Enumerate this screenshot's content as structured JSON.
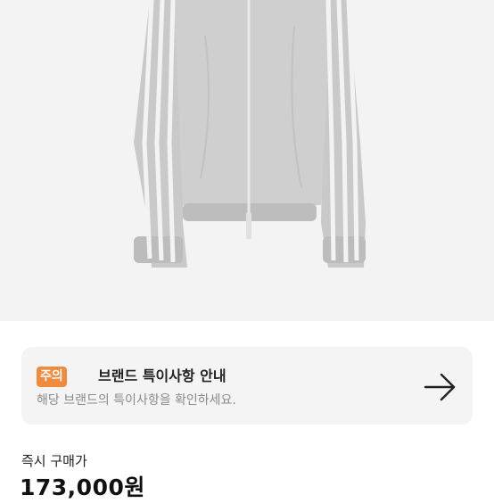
{
  "product": {
    "image_icon": "grey-track-jacket-image"
  },
  "notice": {
    "badge": "주의",
    "title": "브랜드 특이사항 안내",
    "description": "해당 브랜드의 특이사항을 확인하세요.",
    "arrow_icon": "arrow-right-icon",
    "badge_color": "#f08a3c"
  },
  "price": {
    "label": "즉시 구매가",
    "value": "173,000원"
  }
}
